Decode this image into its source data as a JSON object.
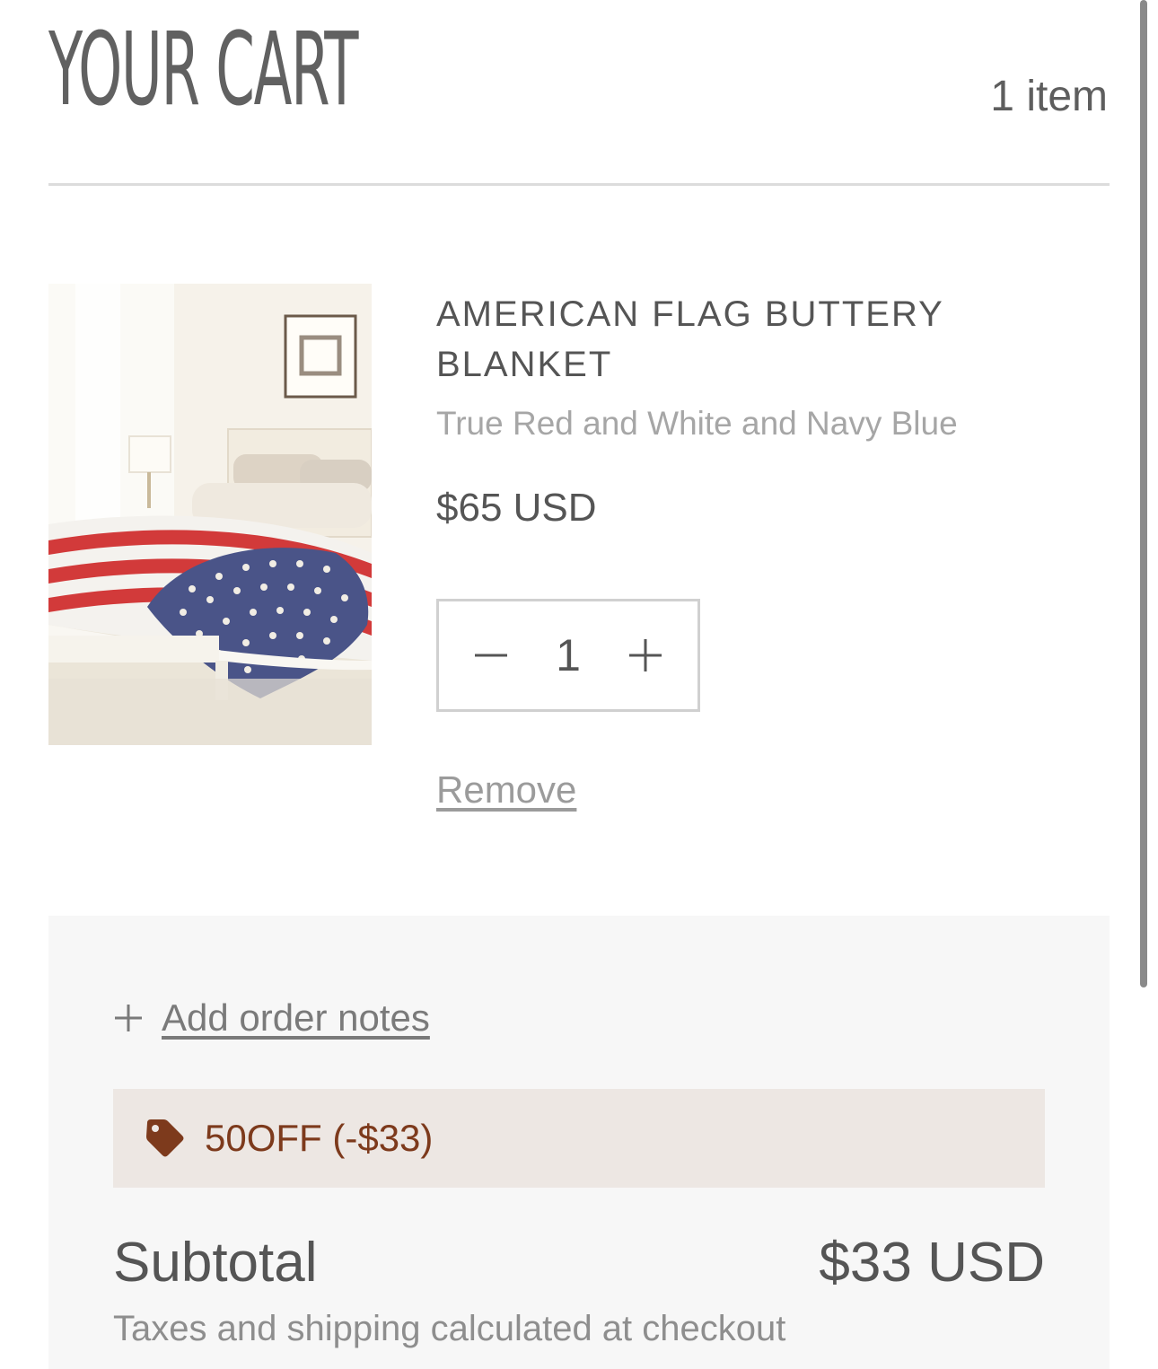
{
  "cart": {
    "title": "YOUR CART",
    "item_count": "1 item"
  },
  "item": {
    "name": "AMERICAN FLAG BUTTERY BLANKET",
    "variant": "True Red and White and Navy Blue",
    "price": "$65 USD",
    "quantity": "1",
    "remove_label": "Remove",
    "decrease_icon": "minus-icon",
    "increase_icon": "plus-icon"
  },
  "summary": {
    "notes_label": "Add order notes",
    "notes_icon": "plus-icon",
    "discount_icon": "tag-icon",
    "discount_text": "50OFF (-$33)",
    "subtotal_label": "Subtotal",
    "subtotal_value": "$33 USD",
    "tax_note": "Taxes and shipping calculated at checkout"
  },
  "colors": {
    "discount_accent": "#7d3a1c",
    "discount_bg": "#ede7e3",
    "summary_bg": "#f7f7f7"
  }
}
